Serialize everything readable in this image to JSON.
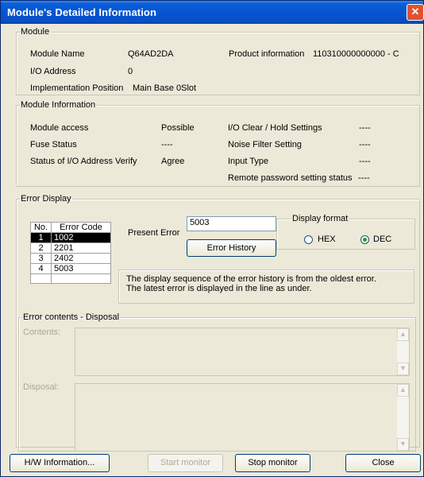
{
  "window": {
    "title": "Module's Detailed Information",
    "close_glyph": "✕"
  },
  "module": {
    "legend": "Module",
    "name_label": "Module Name",
    "name_value": "Q64AD2DA",
    "product_label": "Product information",
    "product_value": "110310000000000 - C",
    "io_label": "I/O Address",
    "io_value": "0",
    "impl_label": "Implementation Position",
    "impl_value": "Main Base  0Slot"
  },
  "module_info": {
    "legend": "Module Information",
    "rows": [
      {
        "label": "Module access",
        "value": "Possible"
      },
      {
        "label": "Fuse Status",
        "value": "----"
      },
      {
        "label": "Status of I/O Address Verify",
        "value": "Agree"
      }
    ],
    "right_rows": [
      {
        "label": "I/O Clear / Hold Settings",
        "value": "----"
      },
      {
        "label": "Noise Filter Setting",
        "value": "----"
      },
      {
        "label": "Input Type",
        "value": "----"
      },
      {
        "label": "Remote password setting status",
        "value": "----"
      }
    ]
  },
  "error_display": {
    "legend": "Error Display",
    "columns": [
      "No.",
      "Error Code"
    ],
    "rows": [
      {
        "no": "1",
        "code": "1002"
      },
      {
        "no": "2",
        "code": "2201"
      },
      {
        "no": "3",
        "code": "2402"
      },
      {
        "no": "4",
        "code": "5003"
      }
    ],
    "present_error_label": "Present Error",
    "present_error_value": "5003",
    "error_history_button": "Error History",
    "display_format": {
      "legend": "Display format",
      "hex": "HEX",
      "dec": "DEC",
      "selected": "DEC"
    },
    "note_line1": "The display sequence of the error history is from the oldest error.",
    "note_line2": "The latest error is displayed in the line as under."
  },
  "error_contents": {
    "legend": "Error contents - Disposal",
    "contents_label": "Contents:",
    "disposal_label": "Disposal:"
  },
  "buttons": {
    "hw_info": "H/W Information...",
    "start_monitor": "Start monitor",
    "stop_monitor": "Stop monitor",
    "close": "Close"
  }
}
